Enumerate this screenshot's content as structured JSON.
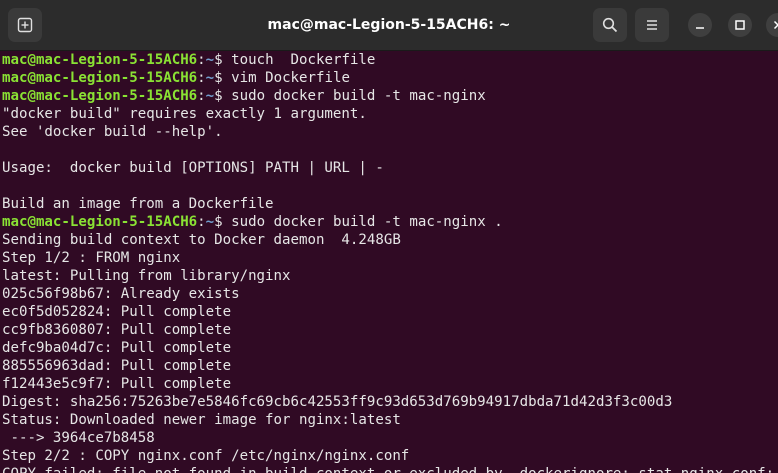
{
  "window": {
    "title": "mac@mac-Legion-5-15ACH6: ~",
    "new_tab_icon": "new-tab-icon",
    "search_icon": "search-icon",
    "menu_icon": "hamburger-menu-icon",
    "minimize_icon": "minimize-icon",
    "maximize_icon": "maximize-icon",
    "close_icon": "close-icon"
  },
  "colors": {
    "background": "#300a24",
    "prompt_user": "#8ae234",
    "prompt_path": "#729fcf",
    "text": "#e6e6e6"
  },
  "prompt": {
    "user": "mac@mac-Legion-5-15ACH6",
    "path": "~",
    "symbol": "$ "
  },
  "lines": [
    {
      "type": "cmd",
      "text": "touch  Dockerfile"
    },
    {
      "type": "cmd",
      "text": "vim Dockerfile"
    },
    {
      "type": "cmd",
      "text": "sudo docker build -t mac-nginx"
    },
    {
      "type": "out",
      "text": "\"docker build\" requires exactly 1 argument."
    },
    {
      "type": "out",
      "text": "See 'docker build --help'."
    },
    {
      "type": "out",
      "text": ""
    },
    {
      "type": "out",
      "text": "Usage:  docker build [OPTIONS] PATH | URL | -"
    },
    {
      "type": "out",
      "text": ""
    },
    {
      "type": "out",
      "text": "Build an image from a Dockerfile"
    },
    {
      "type": "cmd",
      "text": "sudo docker build -t mac-nginx ."
    },
    {
      "type": "out",
      "text": "Sending build context to Docker daemon  4.248GB"
    },
    {
      "type": "out",
      "text": "Step 1/2 : FROM nginx"
    },
    {
      "type": "out",
      "text": "latest: Pulling from library/nginx"
    },
    {
      "type": "out",
      "text": "025c56f98b67: Already exists"
    },
    {
      "type": "out",
      "text": "ec0f5d052824: Pull complete"
    },
    {
      "type": "out",
      "text": "cc9fb8360807: Pull complete"
    },
    {
      "type": "out",
      "text": "defc9ba04d7c: Pull complete"
    },
    {
      "type": "out",
      "text": "885556963dad: Pull complete"
    },
    {
      "type": "out",
      "text": "f12443e5c9f7: Pull complete"
    },
    {
      "type": "out",
      "text": "Digest: sha256:75263be7e5846fc69cb6c42553ff9c93d653d769b94917dbda71d42d3f3c00d3"
    },
    {
      "type": "out",
      "text": "Status: Downloaded newer image for nginx:latest"
    },
    {
      "type": "out",
      "text": " ---> 3964ce7b8458"
    },
    {
      "type": "out",
      "text": "Step 2/2 : COPY nginx.conf /etc/nginx/nginx.conf"
    },
    {
      "type": "out",
      "text": "COPY failed: file not found in build context or excluded by .dockerignore: stat nginx.conf: file does not exist"
    }
  ]
}
